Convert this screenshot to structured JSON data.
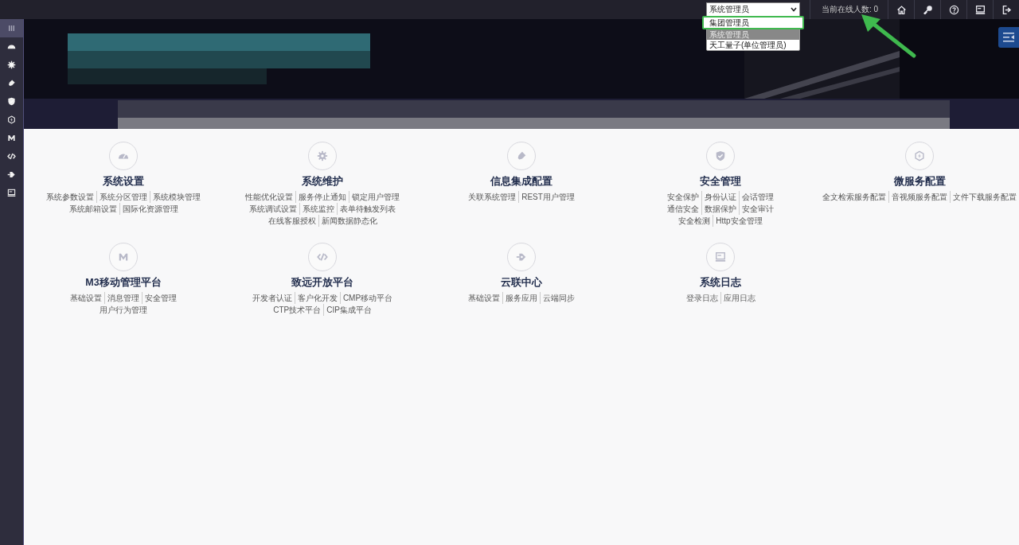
{
  "top_bar": {
    "role_select": {
      "value": "系统管理员",
      "options": [
        {
          "label": "集团管理员",
          "selected": false,
          "highlighted": true
        },
        {
          "label": "系统管理员",
          "selected": true,
          "highlighted": false
        },
        {
          "label": "天工量子(单位管理员)",
          "selected": false,
          "highlighted": false
        }
      ]
    },
    "online_count": "当前在线人数: 0",
    "tools": [
      {
        "kind": "home"
      },
      {
        "kind": "key"
      },
      {
        "kind": "help"
      },
      {
        "kind": "monitor"
      },
      {
        "kind": "logout"
      }
    ]
  },
  "sidebar": {
    "items": [
      {
        "kind": "menu",
        "selected": true
      },
      {
        "kind": "dashboard",
        "selected": false
      },
      {
        "kind": "gear",
        "selected": false
      },
      {
        "kind": "plug",
        "selected": false
      },
      {
        "kind": "shield",
        "selected": false
      },
      {
        "kind": "hexagon",
        "selected": false
      },
      {
        "kind": "m",
        "selected": false
      },
      {
        "kind": "code",
        "selected": false
      },
      {
        "kind": "connector",
        "selected": false
      },
      {
        "kind": "monitor",
        "selected": false
      }
    ]
  },
  "modules": [
    {
      "kind": "dashboard",
      "title": "系统设置",
      "lines": [
        [
          "系统参数设置",
          "系统分区管理",
          "系统模块管理"
        ],
        [
          "系统邮箱设置",
          "国际化资源管理"
        ]
      ]
    },
    {
      "kind": "gear",
      "title": "系统维护",
      "lines": [
        [
          "性能优化设置",
          "服务停止通知",
          "锁定用户管理"
        ],
        [
          "系统调试设置",
          "系统监控",
          "表单待触发列表"
        ],
        [
          "在线客服授权",
          "新闻数据静态化"
        ]
      ]
    },
    {
      "kind": "plug",
      "title": "信息集成配置",
      "lines": [
        [
          "关联系统管理",
          "REST用户管理"
        ]
      ]
    },
    {
      "kind": "shield",
      "title": "安全管理",
      "lines": [
        [
          "安全保护",
          "身份认证",
          "会话管理"
        ],
        [
          "通信安全",
          "数据保护",
          "安全审计"
        ],
        [
          "安全检测",
          "Http安全管理"
        ]
      ]
    },
    {
      "kind": "hexagon",
      "title": "微服务配置",
      "lines": [
        [
          "全文检索服务配置",
          "音视频服务配置",
          "文件下载服务配置"
        ]
      ]
    },
    {
      "kind": "m",
      "title": "M3移动管理平台",
      "lines": [
        [
          "基础设置",
          "消息管理",
          "安全管理"
        ],
        [
          "用户行为管理"
        ]
      ]
    },
    {
      "kind": "code",
      "title": "致远开放平台",
      "lines": [
        [
          "开发者认证",
          "客户化开发",
          "CMP移动平台"
        ],
        [
          "CTP技术平台",
          "CIP集成平台"
        ]
      ]
    },
    {
      "kind": "connector",
      "title": "云联中心",
      "lines": [
        [
          "基础设置",
          "服务应用",
          "云端同步"
        ]
      ]
    },
    {
      "kind": "monitor",
      "title": "系统日志",
      "lines": [
        [
          "登录日志",
          "应用日志"
        ]
      ]
    }
  ]
}
